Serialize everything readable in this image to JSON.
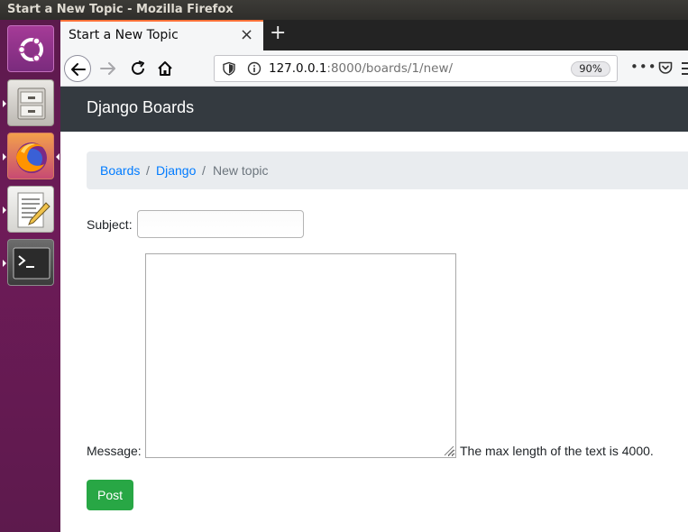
{
  "window": {
    "title": "Start a New Topic - Mozilla Firefox"
  },
  "launcher": {
    "items": [
      {
        "name": "ubuntu-logo-icon"
      },
      {
        "name": "files-icon"
      },
      {
        "name": "firefox-icon"
      },
      {
        "name": "text-editor-icon"
      },
      {
        "name": "terminal-icon"
      }
    ]
  },
  "browser": {
    "tab_title": "Start a New Topic",
    "tab_close": "×",
    "new_tab": "+",
    "url_host": "127.0.0.1",
    "url_rest": ":8000/boards/1/new/",
    "zoom": "90%",
    "menu": "•••",
    "accent_color": "#ff7139"
  },
  "site": {
    "brand": "Django Boards",
    "navbar_color": "#343a40"
  },
  "breadcrumb": {
    "items": [
      "Boards",
      "Django",
      "New topic"
    ],
    "separator": "/"
  },
  "form": {
    "subject_label": "Subject:",
    "subject_value": "",
    "message_label": "Message:",
    "message_value": "",
    "help_text": "The max length of the text is 4000.",
    "submit_label": "Post",
    "submit_color": "#28a745"
  }
}
